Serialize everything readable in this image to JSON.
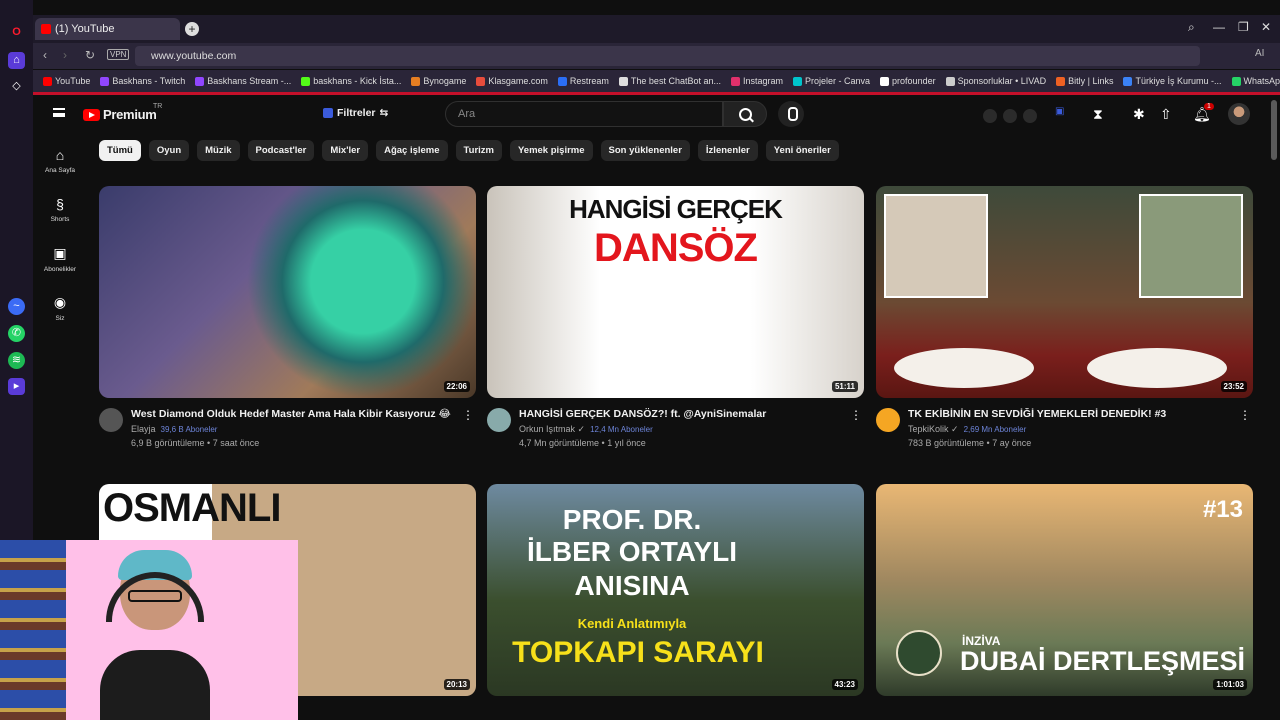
{
  "browser": {
    "tab_title": "(1) YouTube",
    "url": "www.youtube.com",
    "vpn_label": "VPN",
    "bookmarks": [
      "YouTube",
      "Baskhans - Twitch",
      "Baskhans Stream -...",
      "baskhans - Kick İsta...",
      "Bynogame",
      "Klasgame.com",
      "Restream",
      "The best ChatBot an...",
      "Instagram",
      "Projeler - Canva",
      "profounder",
      "Sponsorluklar • LIVAD",
      "Bitly | Links",
      "Türkiye İş Kurumu -...",
      "WhatsApp"
    ],
    "ai_label": "AI"
  },
  "header": {
    "logo_text": "Premium",
    "region": "TR",
    "filters_label": "Filtreler",
    "search_placeholder": "Ara",
    "notification_count": "1"
  },
  "leftnav": {
    "items": [
      {
        "label": "Ana Sayfa",
        "icon": "home-icon"
      },
      {
        "label": "Shorts",
        "icon": "shorts-icon"
      },
      {
        "label": "Abonelikler",
        "icon": "subscriptions-icon"
      },
      {
        "label": "Siz",
        "icon": "you-icon"
      }
    ]
  },
  "chips": [
    "Tümü",
    "Oyun",
    "Müzik",
    "Podcast'ler",
    "Mix'ler",
    "Ağaç işleme",
    "Turizm",
    "Yemek pişirme",
    "Son yüklenenler",
    "İzlenenler",
    "Yeni öneriler"
  ],
  "videos": [
    {
      "title": "West Diamond Olduk Hedef Master Ama Hala Kibir Kasıyoruz 😂",
      "channel": "Elayja",
      "subs": "39,6 B Aboneler",
      "stats": "6,9 B görüntüleme • 7 saat önce",
      "duration": "22:06",
      "thumb_text": ""
    },
    {
      "title": "HANGİSİ GERÇEK DANSÖZ?! ft. @AyniSinemalar",
      "channel": "Orkun Işıtmak ✓",
      "subs": "12,4 Mn Aboneler",
      "stats": "4,7 Mn görüntüleme • 1 yıl önce",
      "duration": "51:11",
      "thumb_text": "HANGİSİ GERÇEK",
      "thumb_text2": "DANSÖZ"
    },
    {
      "title": "TK EKİBİNİN EN SEVDİĞİ YEMEKLERİ DENEDİK! #3",
      "channel": "TepkiKolik ✓",
      "subs": "2,69 Mn Aboneler",
      "stats": "783 B görüntüleme • 7 ay önce",
      "duration": "23:52",
      "thumb_text": ""
    },
    {
      "title": "",
      "channel": "",
      "subs": "",
      "stats": "",
      "duration": "20:13",
      "thumb_text": "OSMANLI"
    },
    {
      "title": "",
      "channel": "",
      "subs": "",
      "stats": "",
      "duration": "43:23",
      "thumb_text": "PROF. DR.",
      "thumb_text2": "İLBER ORTAYLI",
      "thumb_text3": "ANISINA",
      "thumb_text4": "Kendi Anlatımıyla",
      "thumb_text5": "TOPKAPI SARAYI"
    },
    {
      "title": "",
      "channel": "",
      "subs": "",
      "stats": "",
      "duration": "1:01:03",
      "thumb_text": "#13",
      "thumb_text2": "İNZİVA",
      "thumb_text3": "DUBAİ DERTLEŞMESİ"
    }
  ],
  "colors": {
    "bg": "#0f0f0f",
    "accent": "#ff0000",
    "chip_active": "#f1f1f1"
  }
}
